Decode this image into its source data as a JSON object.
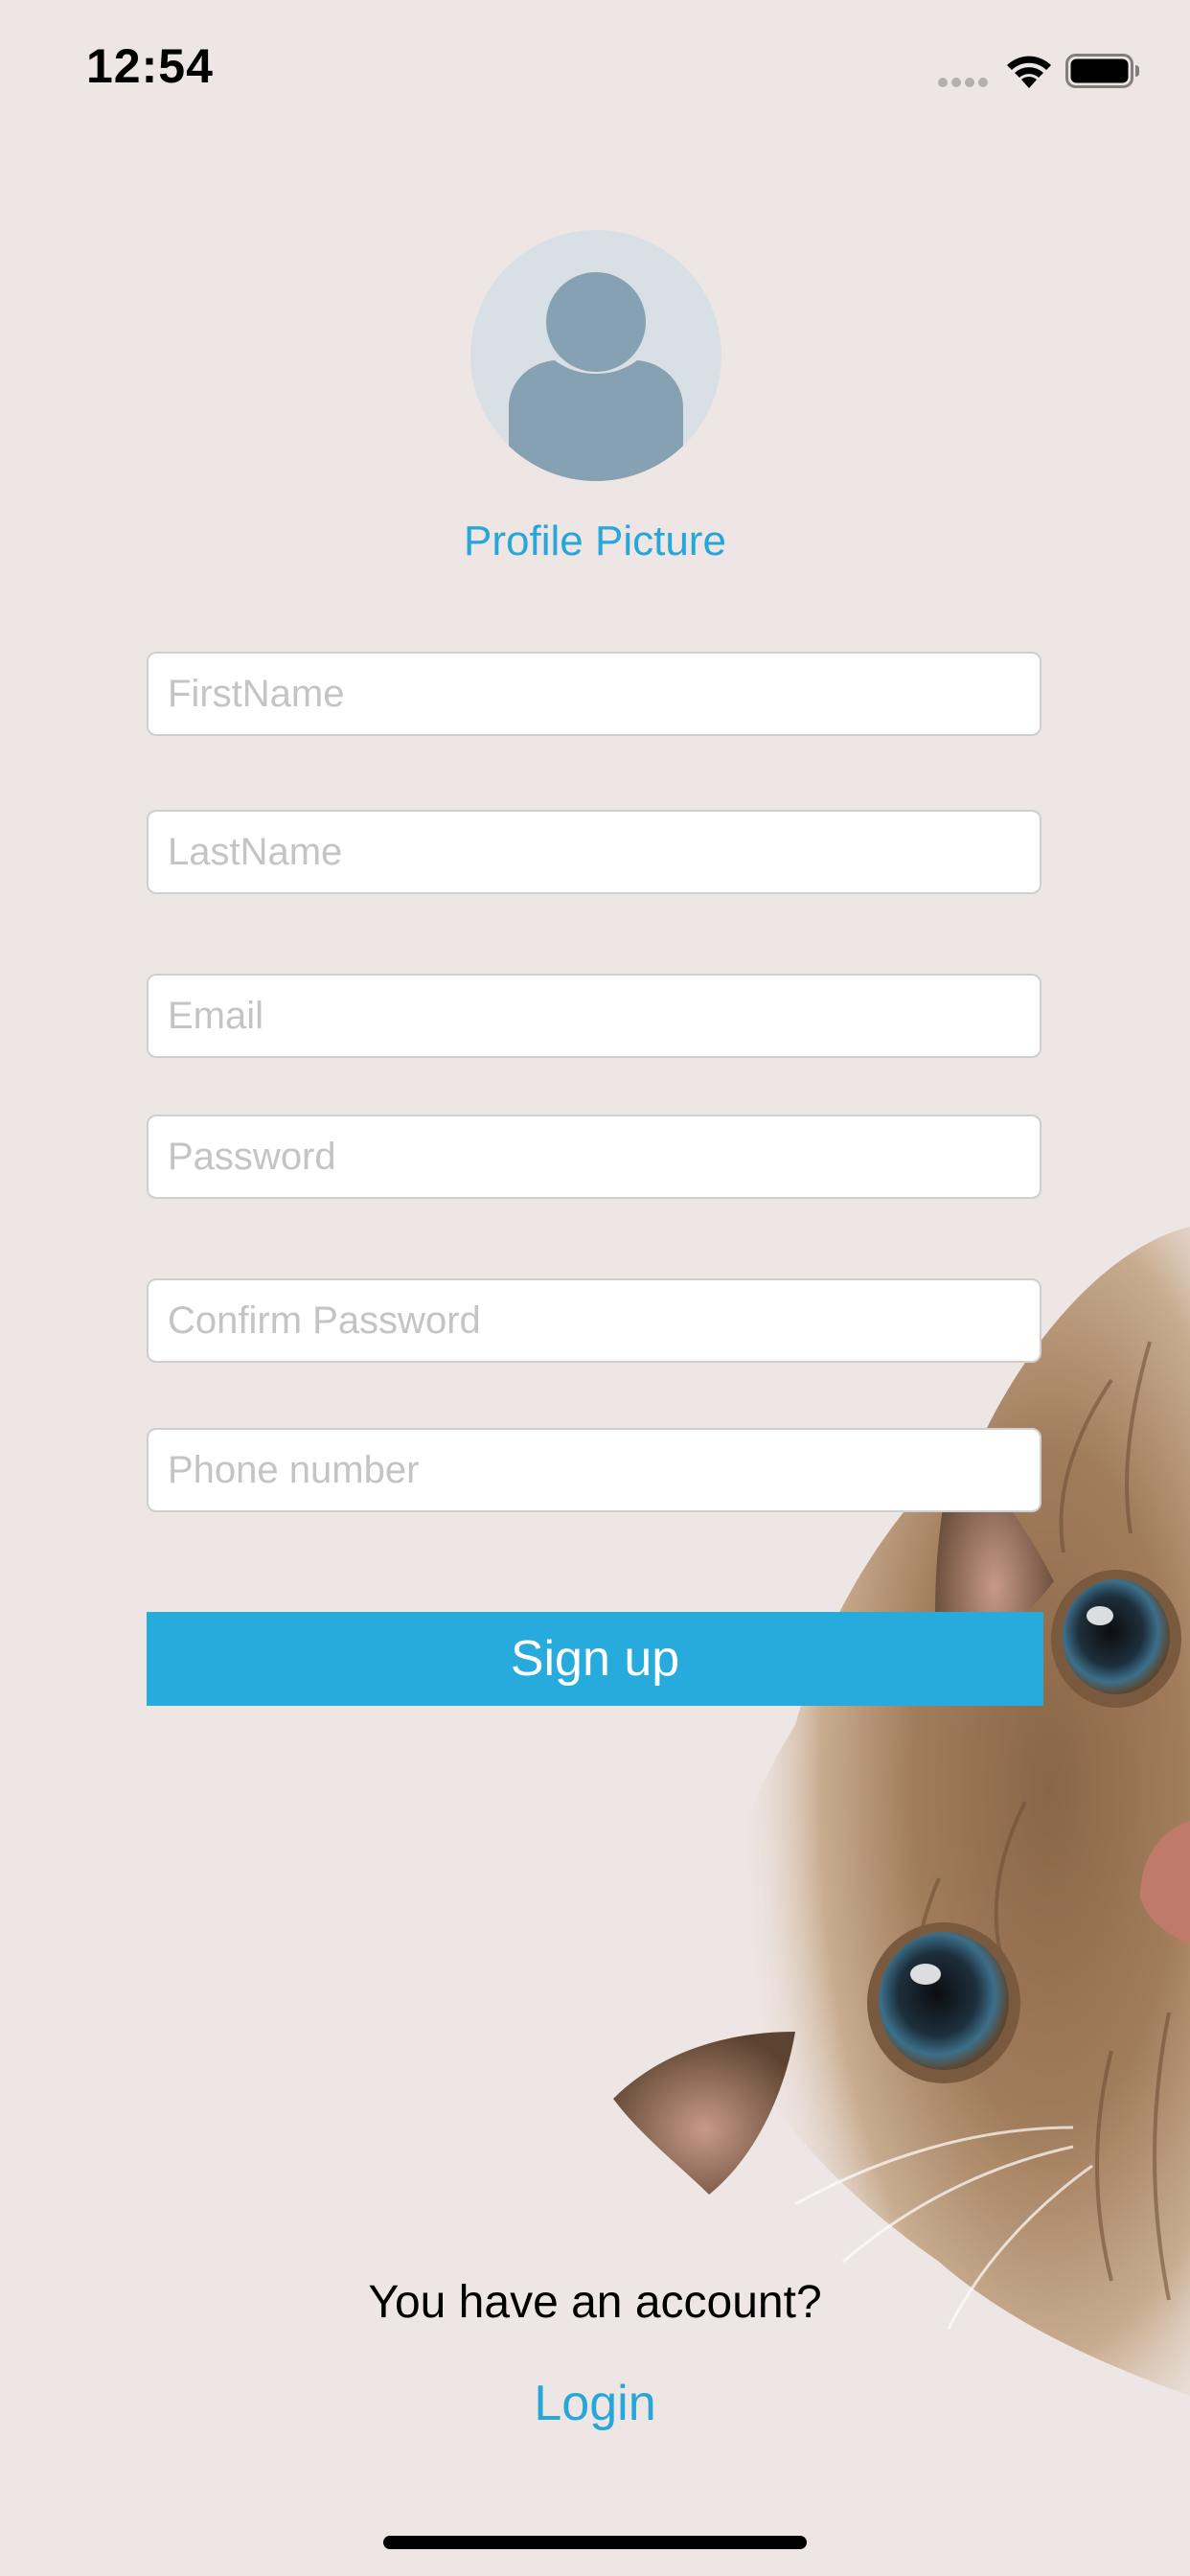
{
  "status_bar": {
    "time": "12:54"
  },
  "profile": {
    "picture_label": "Profile Picture",
    "avatar_icon": "person-silhouette-icon"
  },
  "form": {
    "first_name_placeholder": "FirstName",
    "last_name_placeholder": "LastName",
    "email_placeholder": "Email",
    "password_placeholder": "Password",
    "confirm_password_placeholder": "Confirm Password",
    "phone_placeholder": "Phone number",
    "submit_label": "Sign up"
  },
  "footer": {
    "account_prompt": "You have an account?",
    "login_label": "Login"
  },
  "colors": {
    "accent": "#26abdc",
    "background": "#eee6e4",
    "avatar_bg": "#d8e0e6",
    "avatar_fg": "#86a1b1"
  }
}
